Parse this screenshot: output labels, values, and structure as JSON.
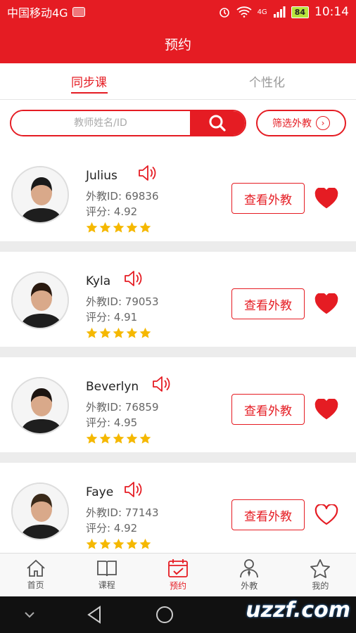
{
  "statusbar": {
    "carrier": "中国移动4G",
    "signal_label": "4G",
    "battery": "84",
    "time": "10:14"
  },
  "header": {
    "title": "预约"
  },
  "tabs": [
    {
      "label": "同步课",
      "active": true
    },
    {
      "label": "个性化",
      "active": false
    }
  ],
  "search": {
    "placeholder": "教师姓名/ID",
    "value": ""
  },
  "filter": {
    "label": "筛选外教"
  },
  "teachers": [
    {
      "name": "Julius",
      "id_text": "外教ID: 69836",
      "score_text": "评分: 4.92",
      "stars": 5,
      "button": "查看外教",
      "favorited": true
    },
    {
      "name": "Kyla",
      "id_text": "外教ID: 79053",
      "score_text": "评分: 4.91",
      "stars": 5,
      "button": "查看外教",
      "favorited": true
    },
    {
      "name": "Beverlyn",
      "id_text": "外教ID: 76859",
      "score_text": "评分: 4.95",
      "stars": 5,
      "button": "查看外教",
      "favorited": true
    },
    {
      "name": "Faye",
      "id_text": "外教ID: 77143",
      "score_text": "评分: 4.92",
      "stars": 5,
      "button": "查看外教",
      "favorited": false
    }
  ],
  "nav": [
    {
      "label": "首页",
      "icon": "home-icon"
    },
    {
      "label": "课程",
      "icon": "book-icon"
    },
    {
      "label": "预约",
      "icon": "calendar-icon",
      "active": true
    },
    {
      "label": "外教",
      "icon": "teacher-icon"
    },
    {
      "label": "我的",
      "icon": "star-icon"
    }
  ],
  "watermark": {
    "text": "uzzf.com"
  },
  "colors": {
    "brand": "#e51c23",
    "star": "#f5b800"
  }
}
